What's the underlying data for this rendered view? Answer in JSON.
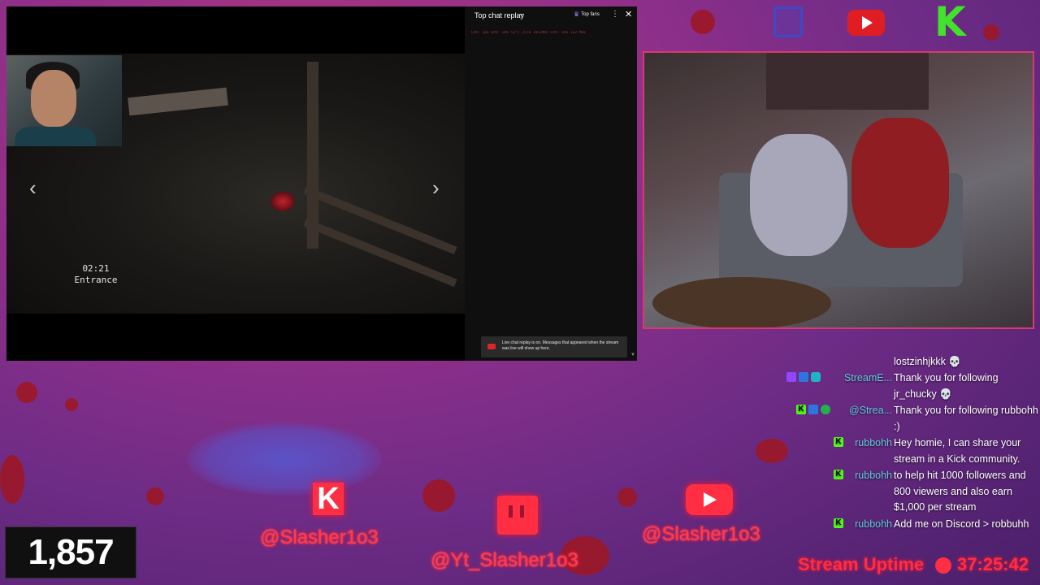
{
  "player": {
    "chat_title": "Top chat replay",
    "top_fans_label": "Top fans",
    "stats_line": "CPU: 3pk    GPU: 20% 53°C 2570 7053MHz    CPU: 16%  132 MHz",
    "replay_notice": "Live chat replay is on. Messages that appeared when the stream was live will show up here.",
    "game_time": "02:21",
    "game_location": "Entrance"
  },
  "chat": {
    "messages": [
      {
        "user": "",
        "badges": [],
        "text": "lostzinhjkkk 💀"
      },
      {
        "user": "StreamE...",
        "badges": [
          "twitch",
          "blue",
          "teal"
        ],
        "text": "Thank you for following jr_chucky 💀"
      },
      {
        "user": "@Strea...",
        "badges": [
          "kick",
          "blue",
          "green"
        ],
        "text": "Thank you for following rubbohh :)"
      },
      {
        "user": "rubbohh",
        "badges": [
          "kick"
        ],
        "text": "Hey homie, I can share your stream in a Kick community."
      },
      {
        "user": "rubbohh",
        "badges": [
          "kick"
        ],
        "text": "to help hit 1000 followers and 800 viewers and also earn $1,000 per stream"
      },
      {
        "user": "rubbohh",
        "badges": [
          "kick"
        ],
        "text": "Add me on Discord > robbuhh"
      }
    ]
  },
  "viewer_count": "1,857",
  "socials": {
    "kick_handle": "@Slasher1o3",
    "twitch_handle": "@Yt_Slasher1o3",
    "youtube_handle": "@Slasher1o3"
  },
  "uptime": {
    "label": "Stream Uptime",
    "time": "37:25:42"
  },
  "colors": {
    "accent_red": "#ff2e42",
    "kick_green": "#53fc18",
    "username_cyan": "#5ecbe0"
  }
}
